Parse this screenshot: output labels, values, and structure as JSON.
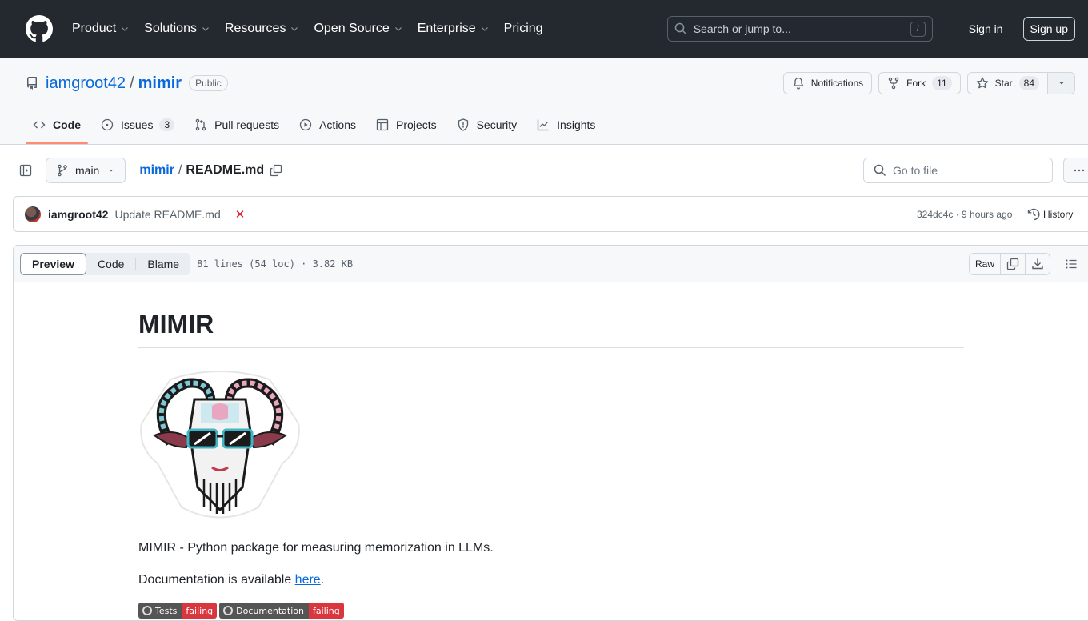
{
  "header": {
    "nav": [
      {
        "label": "Product",
        "has_menu": true
      },
      {
        "label": "Solutions",
        "has_menu": true
      },
      {
        "label": "Resources",
        "has_menu": true
      },
      {
        "label": "Open Source",
        "has_menu": true
      },
      {
        "label": "Enterprise",
        "has_menu": true
      },
      {
        "label": "Pricing",
        "has_menu": false
      }
    ],
    "search_placeholder": "Search or jump to...",
    "search_shortcut": "/",
    "sign_in": "Sign in",
    "sign_up": "Sign up"
  },
  "repo": {
    "owner": "iamgroot42",
    "separator": "/",
    "name": "mimir",
    "visibility": "Public",
    "notifications_label": "Notifications",
    "fork_label": "Fork",
    "fork_count": "11",
    "star_label": "Star",
    "star_count": "84",
    "tabs": [
      {
        "label": "Code",
        "icon": "code-icon",
        "active": true
      },
      {
        "label": "Issues",
        "icon": "issue-icon",
        "count": "3"
      },
      {
        "label": "Pull requests",
        "icon": "pull-request-icon"
      },
      {
        "label": "Actions",
        "icon": "play-icon"
      },
      {
        "label": "Projects",
        "icon": "table-icon"
      },
      {
        "label": "Security",
        "icon": "shield-icon"
      },
      {
        "label": "Insights",
        "icon": "graph-icon"
      }
    ]
  },
  "file_nav": {
    "branch": "main",
    "breadcrumb_root": "mimir",
    "breadcrumb_sep": "/",
    "file_name": "README.md",
    "goto_placeholder": "Go to file"
  },
  "commit": {
    "author": "iamgroot42",
    "message": "Update README.md",
    "status": "failing",
    "sha": "324dc4c",
    "time": "9 hours ago",
    "meta": "324dc4c · 9 hours ago",
    "history_label": "History"
  },
  "file_view": {
    "tabs": [
      "Preview",
      "Code",
      "Blame"
    ],
    "active_tab": "Preview",
    "info": "81 lines (54 loc) · 3.82 KB",
    "raw_label": "Raw"
  },
  "readme": {
    "title": "MIMIR",
    "logo_alt": "ram logo with sunglasses and circuit patterns",
    "description": "MIMIR - Python package for measuring memorization in LLMs.",
    "doc_prefix": "Documentation is available ",
    "doc_link": "here",
    "doc_suffix": ".",
    "badges": [
      {
        "label": "Tests",
        "status": "failing"
      },
      {
        "label": "Documentation",
        "status": "failing"
      }
    ]
  },
  "colors": {
    "header_bg": "#24292f",
    "link": "#0969da",
    "tab_underline": "#fd8c73",
    "fail_red": "#cf222e"
  }
}
